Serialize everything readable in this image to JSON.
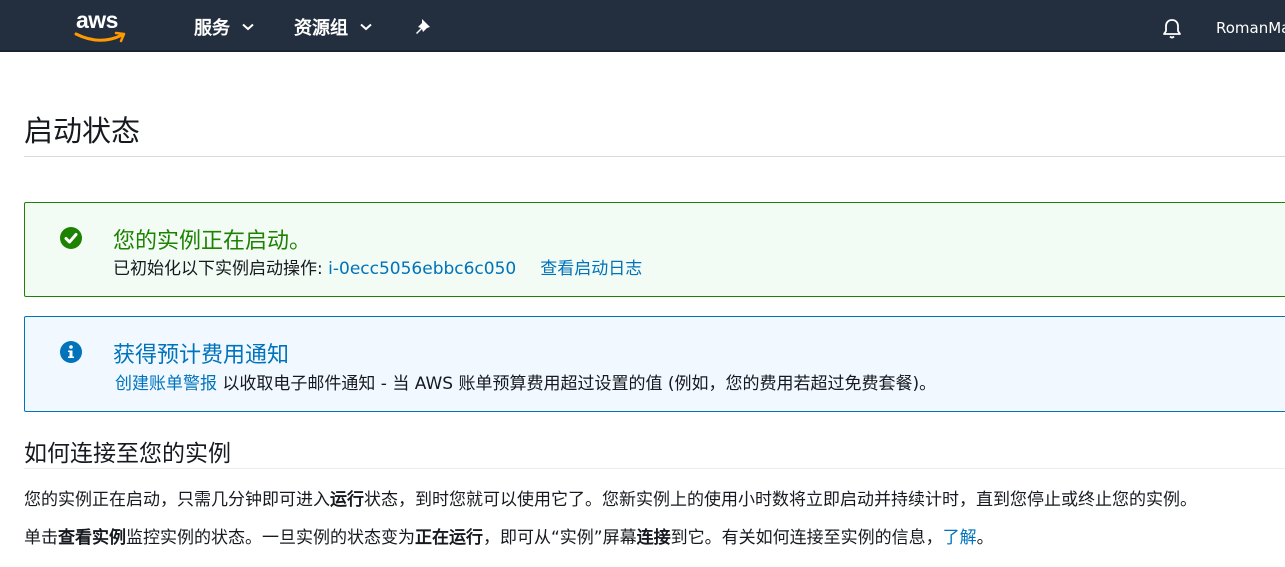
{
  "nav": {
    "logo": "aws",
    "services_label": "服务",
    "groups_label": "资源组",
    "user": "RomanMa",
    "icons": {
      "pin": "pin-icon",
      "bell": "bell-icon",
      "chevron": "chevron-down-icon"
    }
  },
  "page": {
    "title": "启动状态"
  },
  "success_alert": {
    "title": "您的实例正在启动。",
    "body_prefix": "已初始化以下实例启动操作: ",
    "instance_id": "i-0ecc5056ebbc6c050",
    "view_log": "查看启动日志",
    "color": "#1d8102"
  },
  "info_alert": {
    "title": "获得预计费用通知",
    "link": "创建账单警报",
    "body": " 以收取电子邮件通知 - 当 AWS 账单预算费用超过设置的值 (例如，您的费用若超过免费套餐)。",
    "color": "#0073bb"
  },
  "connect": {
    "title": "如何连接至您的实例",
    "p1_a": "您的实例正在启动，只需几分钟即可进入",
    "p1_b": "运行",
    "p1_c": "状态，到时您就可以使用它了。您新实例上的使用小时数将立即启动并持续计时，直到您停止或终止您的实例。",
    "p2_a": "单击",
    "p2_b": "查看实例",
    "p2_c": "监控实例的状态。一旦实例的状态变为",
    "p2_d": "正在运行",
    "p2_e": "，即可从“实例”屏幕",
    "p2_f": "连接",
    "p2_g": "到它。有关如何连接至实例的信息，",
    "p2_link": "了解",
    "p2_end": "。"
  }
}
